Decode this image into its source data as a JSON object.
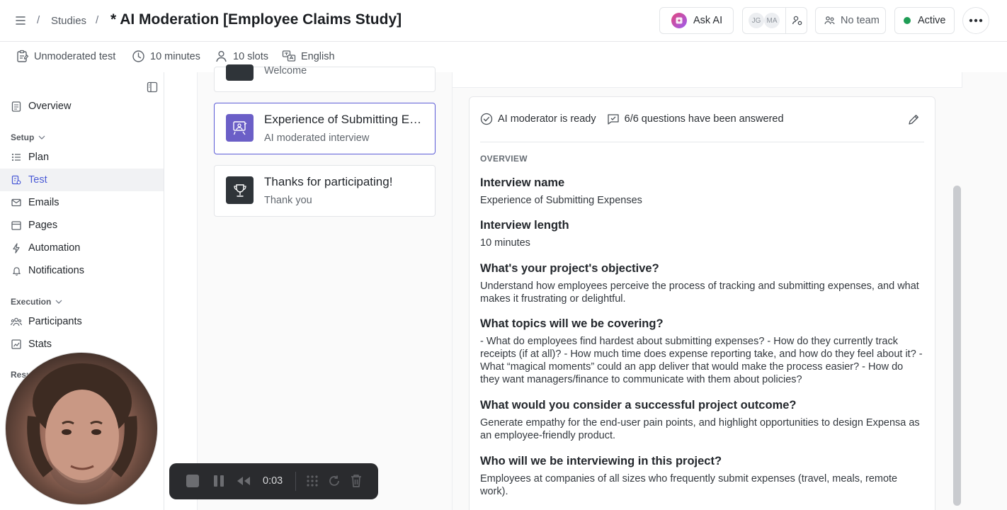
{
  "header": {
    "breadcrumb_sep": "/",
    "studies_label": "Studies",
    "title": "* AI Moderation [Employee Claims Study]",
    "ask_ai_label": "Ask AI",
    "avatars": [
      "JG",
      "MA"
    ],
    "team_label": "No team",
    "status_label": "Active",
    "status_color": "#1f9d55"
  },
  "meta": {
    "test_type": "Unmoderated test",
    "duration": "10 minutes",
    "slots": "10 slots",
    "language": "English"
  },
  "sidebar": {
    "overview": "Overview",
    "setup_section": "Setup",
    "setup_items": [
      "Plan",
      "Test",
      "Emails",
      "Pages",
      "Automation",
      "Notifications"
    ],
    "execution_section": "Execution",
    "execution_items": [
      "Participants",
      "Stats"
    ],
    "results_section_partial": "Resu",
    "active_item": "Test",
    "accent_color": "#4b5bd6"
  },
  "steps": [
    {
      "title": "",
      "subtitle": "Welcome"
    },
    {
      "title": "Experience of Submitting Expenses",
      "subtitle": "AI moderated interview"
    },
    {
      "title": "Thanks for participating!",
      "subtitle": "Thank you"
    }
  ],
  "panel": {
    "ready_text": "AI moderator is ready",
    "answered_text": "6/6 questions have been answered",
    "overview_label": "OVERVIEW",
    "fields": [
      {
        "q": "Interview name",
        "a": "Experience of Submitting Expenses"
      },
      {
        "q": "Interview length",
        "a": "10 minutes"
      },
      {
        "q": "What's your project's objective?",
        "a": "Understand how employees perceive the process of tracking and submitting expenses, and what makes it frustrating or delightful."
      },
      {
        "q": "What topics will we be covering?",
        "a": "- What do employees find hardest about submitting expenses? - How do they currently track receipts (if at all)? - How much time does expense reporting take, and how do they feel about it? - What “magical moments” could an app deliver that would make the process easier? - How do they want managers/finance to communicate with them about policies?"
      },
      {
        "q": "What would you consider a successful project outcome?",
        "a": "Generate empathy for the end-user pain points, and highlight opportunities to design Expensa as an employee-friendly product."
      },
      {
        "q": "Who will we be interviewing in this project?",
        "a": "Employees at companies of all sizes who frequently submit expenses (travel, meals, remote work)."
      }
    ]
  },
  "recorder": {
    "time": "0:03"
  }
}
